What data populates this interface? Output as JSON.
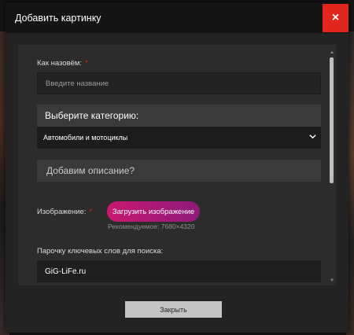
{
  "modal": {
    "title": "Добавить картинку",
    "close_icon": "×"
  },
  "form": {
    "name_label": "Как назовём:",
    "required_mark": "*",
    "name_placeholder": "Введите название",
    "category_prompt": "Выберите категорию:",
    "category_selected": "Автомобили и мотоциклы",
    "description_prompt": "Добавим описание?",
    "image_label": "Изображение:",
    "upload_button": "Загрузить изображение",
    "recommended_hint": "Рекомендуемое: 7680×4320",
    "keywords_label": "Парочку ключевых слов для поиска:",
    "keywords_value": "GiG-LiFe.ru"
  },
  "footer": {
    "close_button": "Закрыть"
  },
  "colors": {
    "accent_red": "#e0261f",
    "upload_gradient_start": "#c9186f",
    "upload_gradient_end": "#8e1a7a"
  },
  "icons": {
    "close": "close-icon",
    "select_arrow": "chevron-down-icon",
    "scroll_up": "caret-up-icon",
    "scroll_down": "caret-down-icon"
  }
}
